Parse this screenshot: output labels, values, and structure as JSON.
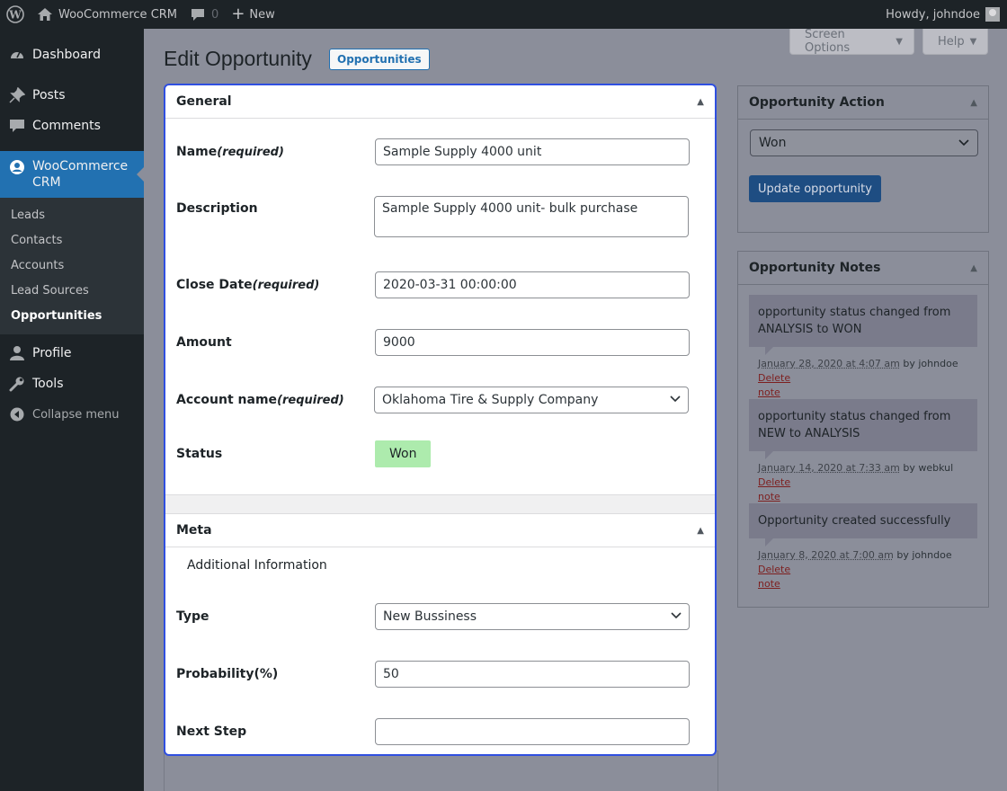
{
  "admin_bar": {
    "site_name": "WooCommerce CRM",
    "comments_count": "0",
    "new_label": "New",
    "howdy": "Howdy, johndoe"
  },
  "sidebar": {
    "dashboard": "Dashboard",
    "posts": "Posts",
    "comments": "Comments",
    "crm_label": "WooCommerce CRM",
    "submenu": [
      "Leads",
      "Contacts",
      "Accounts",
      "Lead Sources",
      "Opportunities"
    ],
    "profile": "Profile",
    "tools": "Tools",
    "collapse": "Collapse menu"
  },
  "screen_meta": {
    "screen_options": "Screen Options",
    "help": "Help"
  },
  "page": {
    "title": "Edit Opportunity",
    "action_label": "Opportunities"
  },
  "general": {
    "heading": "General",
    "name_label": "Name",
    "required": "(required)",
    "name_value": "Sample Supply 4000 unit",
    "description_label": "Description",
    "description_value": "Sample Supply 4000 unit- bulk purchase",
    "close_date_label": "Close Date",
    "close_date_value": "2020-03-31 00:00:00",
    "amount_label": "Amount",
    "amount_value": "9000",
    "account_label": "Account name",
    "account_value": "Oklahoma Tire & Supply Company",
    "status_label": "Status",
    "status_value": "Won",
    "status_color": "#adebad"
  },
  "meta": {
    "heading": "Meta",
    "additional_info": "Additional Information",
    "type_label": "Type",
    "type_value": "New Bussiness",
    "probability_label": "Probability(%)",
    "probability_value": "50",
    "next_step_label": "Next Step",
    "next_step_value": ""
  },
  "opportunity_action": {
    "heading": "Opportunity Action",
    "selected": "Won",
    "update_button": "Update opportunity"
  },
  "opportunity_notes": {
    "heading": "Opportunity Notes",
    "notes": [
      {
        "text": "opportunity status changed from ANALYSIS to WON",
        "date": "January 28, 2020 at 4:07 am",
        "by": "by johndoe",
        "delete_1": "Delete",
        "delete_2": "note"
      },
      {
        "text": "opportunity status changed from NEW to ANALYSIS",
        "date": "January 14, 2020 at 7:33 am",
        "by": "by webkul",
        "delete_1": "Delete",
        "delete_2": "note"
      },
      {
        "text": "Opportunity created successfully",
        "date": "January 8, 2020 at 7:00 am",
        "by": "by johndoe",
        "delete_1": "Delete",
        "delete_2": "note"
      }
    ]
  }
}
